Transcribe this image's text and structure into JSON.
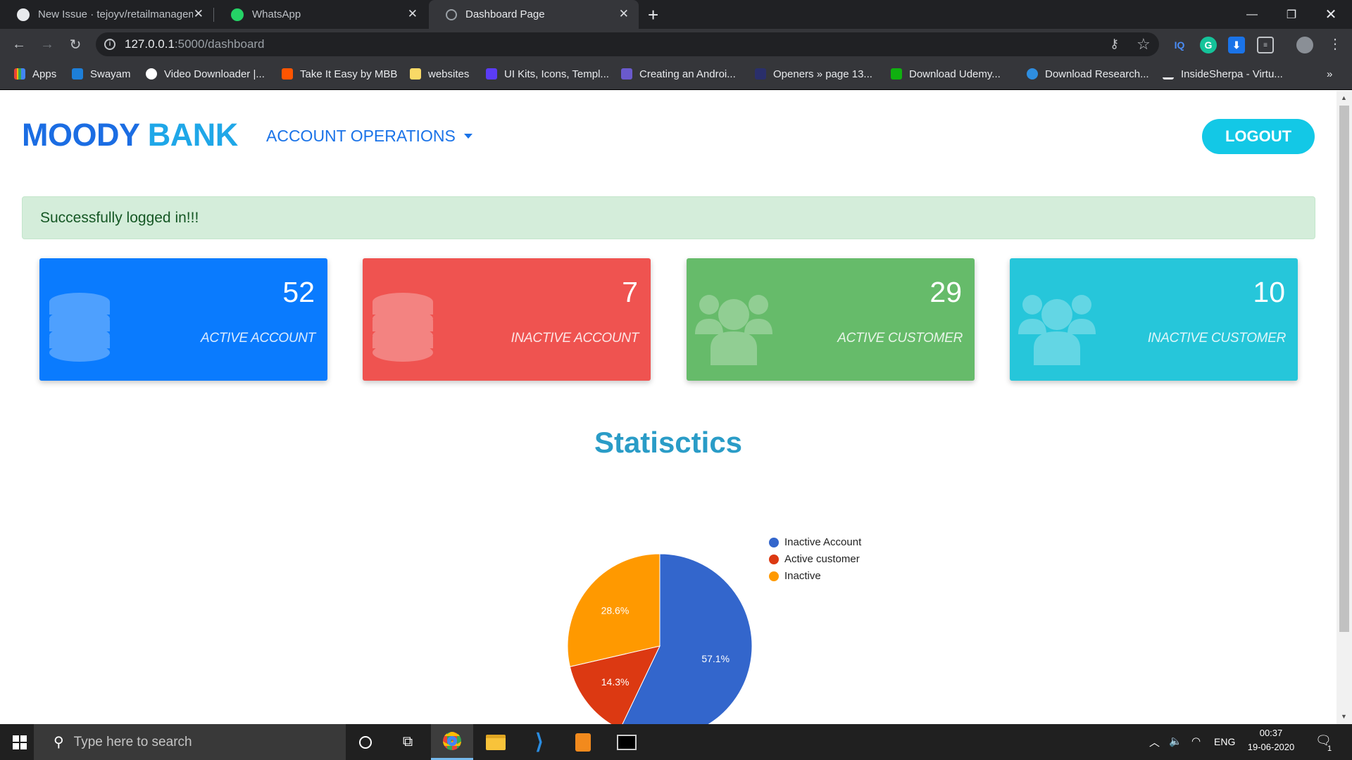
{
  "browser": {
    "tabs": [
      {
        "title": "New Issue · tejoyv/retailmanagem"
      },
      {
        "title": "WhatsApp"
      },
      {
        "title": "Dashboard Page"
      }
    ],
    "url_host": "127.0.0.1",
    "url_path": ":5000/dashboard",
    "bookmarks": [
      {
        "label": "Apps"
      },
      {
        "label": "Swayam"
      },
      {
        "label": "Video Downloader |..."
      },
      {
        "label": "Take It Easy by MBB"
      },
      {
        "label": "websites"
      },
      {
        "label": "UI Kits, Icons, Templ..."
      },
      {
        "label": "Creating an Androi..."
      },
      {
        "label": "Openers » page 13..."
      },
      {
        "label": "Download Udemy..."
      },
      {
        "label": "Download Research..."
      },
      {
        "label": "InsideSherpa - Virtu..."
      }
    ],
    "more_bookmarks": "»"
  },
  "nav": {
    "brand_part1": "MOODY",
    "brand_part2": "BANK",
    "account_operations": "ACCOUNT OPERATIONS",
    "logout": "LOGOUT"
  },
  "alert": "Successfully logged in!!!",
  "cards": [
    {
      "value": "52",
      "label": "ACTIVE ACCOUNT",
      "color": "#0a7bfe",
      "icon": "database-icon"
    },
    {
      "value": "7",
      "label": "INACTIVE ACCOUNT",
      "color": "#ef5350",
      "icon": "database-icon"
    },
    {
      "value": "29",
      "label": "ACTIVE CUSTOMER",
      "color": "#66bb6a",
      "icon": "users-icon"
    },
    {
      "value": "10",
      "label": "INACTIVE CUSTOMER",
      "color": "#26c6da",
      "icon": "users-icon"
    }
  ],
  "stats_title": "Statisctics",
  "chart_data": {
    "type": "pie",
    "legend_position": "right",
    "slices": [
      {
        "label": "Inactive Account",
        "value": 57.1,
        "display": "57.1%",
        "color": "#3366cc"
      },
      {
        "label": "Active customer",
        "value": 14.3,
        "display": "14.3%",
        "color": "#dc3912"
      },
      {
        "label": "Inactive",
        "value": 28.6,
        "display": "28.6%",
        "color": "#ff9900"
      }
    ]
  },
  "taskbar": {
    "search_placeholder": "Type here to search",
    "language": "ENG",
    "time": "00:37",
    "date": "19-06-2020",
    "notification_count": "1"
  }
}
